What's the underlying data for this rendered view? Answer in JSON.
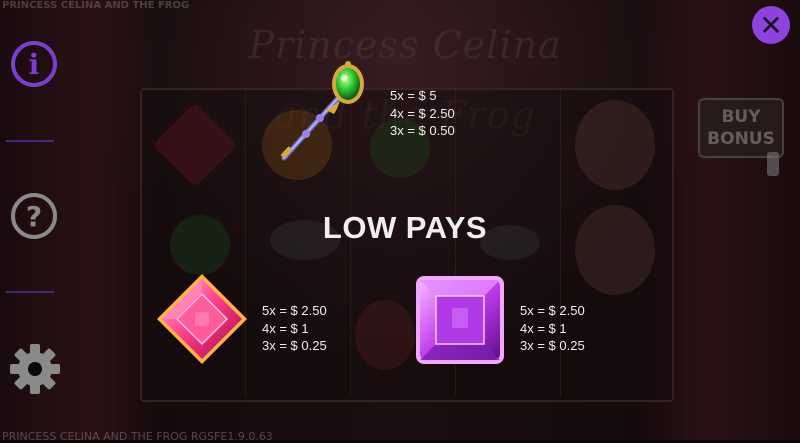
{
  "game": {
    "title_small": "PRINCESS CELINA AND THE FROG",
    "logo_text": "Princess Celina and the Frog",
    "bottom_text": "PRINCESS CELINA AND THE FROG RGSFE1.9.0.63"
  },
  "buy_bonus": {
    "line1": "BUY",
    "line2": "BONUS"
  },
  "sidebar": {
    "info_icon": "info-icon",
    "info_glyph": "i",
    "help_icon": "question-icon",
    "help_glyph": "?",
    "settings_icon": "gear-icon"
  },
  "close": {
    "icon": "close-icon",
    "glyph": "✕"
  },
  "paytable": {
    "heading": "LOW PAYS",
    "symbols": [
      {
        "name": "scepter",
        "icon": "green-gem-scepter-icon",
        "pays": [
          "5x = $ 5",
          "4x = $ 2.50",
          "3x = $ 0.50"
        ]
      },
      {
        "name": "pink-gem",
        "icon": "pink-diamond-gem-icon",
        "pays": [
          "5x = $ 2.50",
          "4x = $ 1",
          "3x = $ 0.25"
        ]
      },
      {
        "name": "purple-gem",
        "icon": "purple-square-gem-icon",
        "pays": [
          "5x = $ 2.50",
          "4x = $ 1",
          "3x = $ 0.25"
        ]
      }
    ]
  },
  "colors": {
    "accent_purple": "#8d43e0",
    "info_purple": "#7a3fd0",
    "help_gray": "#8a8a8a",
    "pink_gem": "#ff3a86",
    "purple_gem": "#c23cf0",
    "green_gem": "#39d23a"
  }
}
